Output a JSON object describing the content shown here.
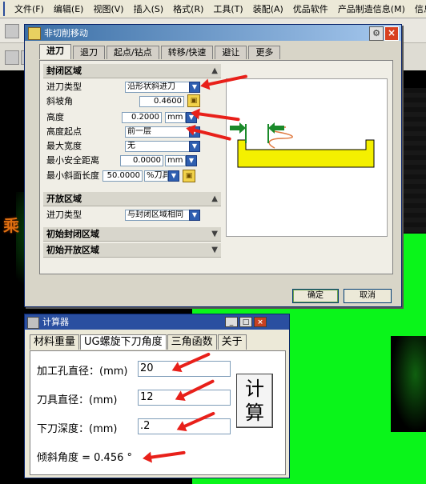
{
  "menubar": {
    "items": [
      "文件(F)",
      "编辑(E)",
      "视图(V)",
      "插入(S)",
      "格式(R)",
      "工具(T)",
      "装配(A)",
      "优品软件",
      "产品制造信息(M)",
      "信息"
    ]
  },
  "dialog": {
    "title": "非切削移动",
    "tabs": [
      "进刀",
      "退刀",
      "起点/钻点",
      "转移/快速",
      "避让",
      "更多"
    ],
    "closed_section": {
      "header": "封闭区域",
      "fields": [
        {
          "label": "进刀类型",
          "value": "沿形状斜进刀"
        },
        {
          "label": "斜坡角",
          "value": "0.4600"
        },
        {
          "label": "高度",
          "value": "0.2000",
          "unit": "mm"
        },
        {
          "label": "高度起点",
          "value": "前一层"
        },
        {
          "label": "最大宽度",
          "value": "无"
        },
        {
          "label": "最小安全距离",
          "value": "0.0000",
          "unit": "mm"
        },
        {
          "label": "最小斜面长度",
          "value": "50.0000",
          "unit": "%刀具"
        }
      ]
    },
    "open_section": {
      "header": "开放区域",
      "fields": [
        {
          "label": "进刀类型",
          "value": "与封闭区域相同"
        }
      ]
    },
    "initial_closed": "初始封闭区域",
    "initial_open": "初始开放区域",
    "ok": "确定",
    "cancel": "取消"
  },
  "calc": {
    "title": "计算器",
    "tabs": [
      "材料重量",
      "UG螺旋下刀角度",
      "三角函数",
      "关于"
    ],
    "fields": [
      {
        "label": "加工孔直径：(mm)",
        "value": "20"
      },
      {
        "label": "刀具直径：(mm)",
        "value": "12"
      },
      {
        "label": "下刀深度：(mm)",
        "value": ".2"
      }
    ],
    "result": "倾斜角度 = 0.456 °",
    "button": "计算"
  },
  "background": {
    "logo": "乘"
  },
  "colors": {
    "arrow": "#e8201a",
    "preview_part": "#f4f000",
    "preview_arrow": "#1a8a2a",
    "preview_spiral": "#e07a40",
    "screen_green": "#0af51a"
  }
}
